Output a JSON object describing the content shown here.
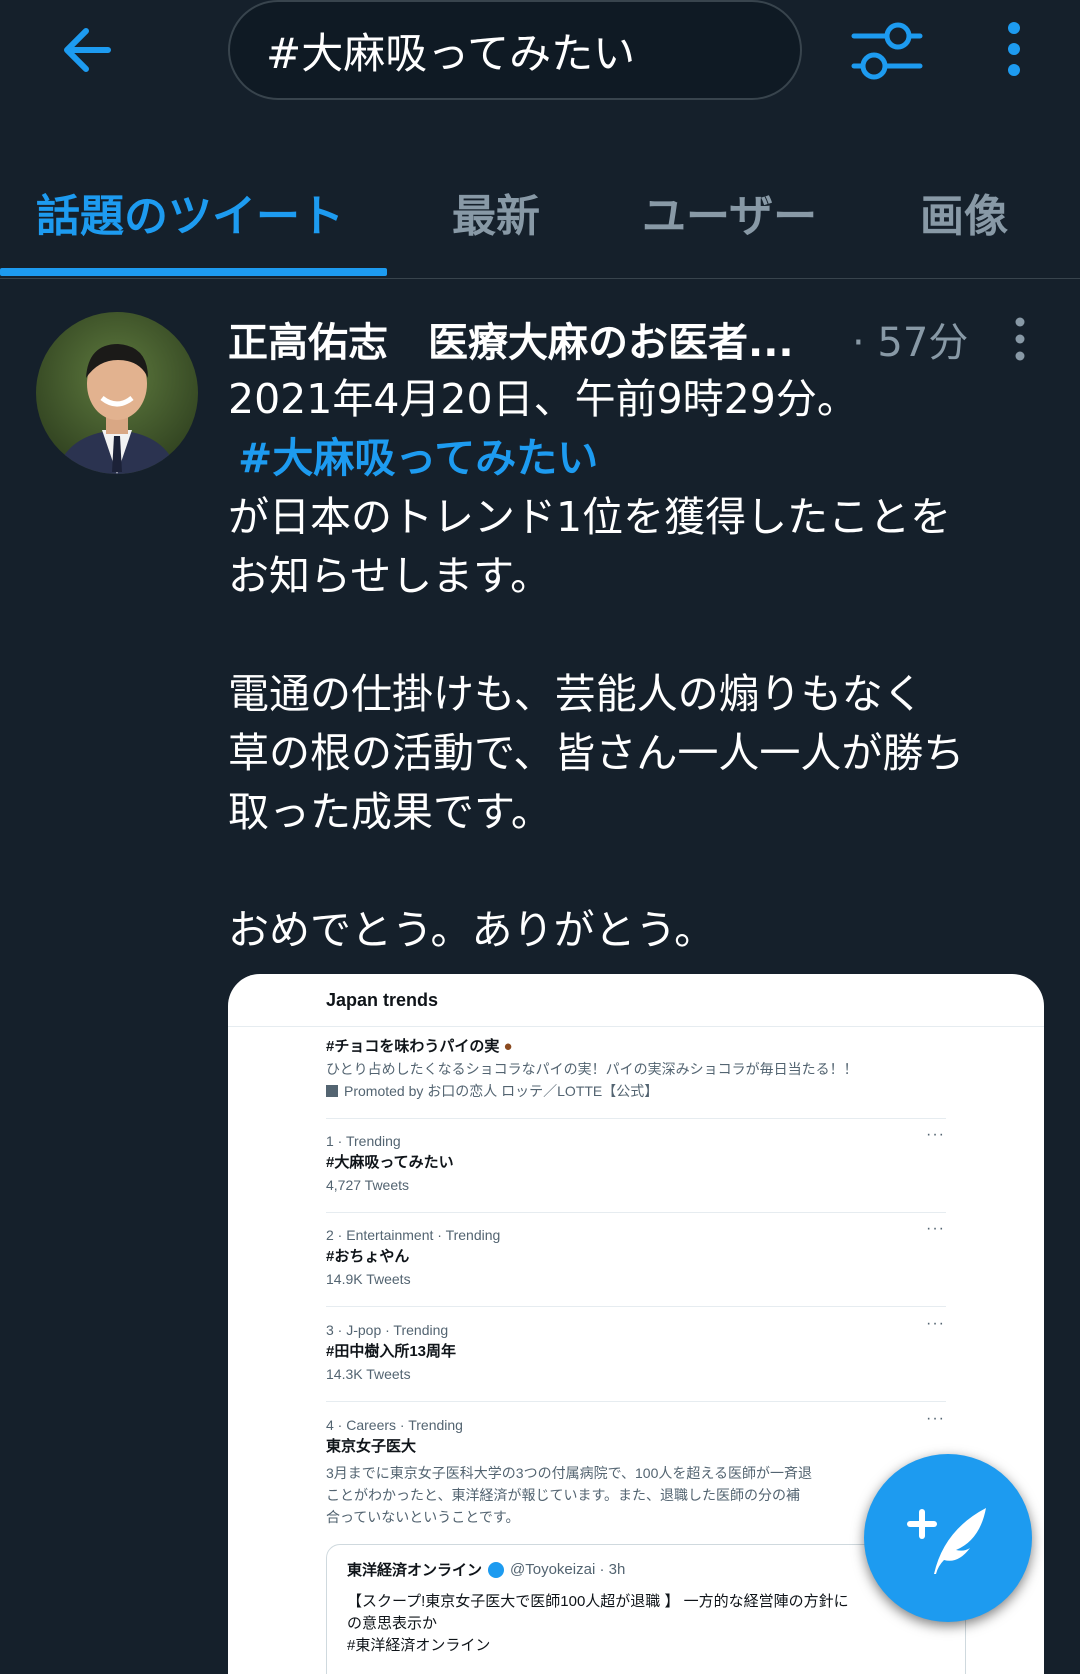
{
  "header": {
    "search_value": "#大麻吸ってみたい",
    "icons": {
      "back": "arrow-left-icon",
      "filter": "sliders-icon",
      "more": "more-vertical-icon"
    }
  },
  "tabs": [
    {
      "label": "話題のツイート",
      "active": true
    },
    {
      "label": "最新",
      "active": false
    },
    {
      "label": "ユーザー",
      "active": false
    },
    {
      "label": "画像",
      "active": false
    }
  ],
  "tweet": {
    "author": "正高佑志　医療大麻のお医者...",
    "time": "· 57分",
    "line1": "2021年4月20日、午前9時29分。",
    "hashtag": "#大麻吸ってみたい",
    "line2": "が日本のトレンド1位を獲得したことを",
    "line3": "お知らせします。",
    "line4": "電通の仕掛けも、芸能人の煽りもなく",
    "line5": "草の根の活動で、皆さん一人一人が勝ち",
    "line6": "取った成果です。",
    "line7": "おめでとう。ありがとう。"
  },
  "media": {
    "title": "Japan trends",
    "promoted": {
      "tag": "#チョコを味わうパイの実",
      "desc": "ひとり占めしたくなるショコラなパイの実！パイの実深みショコラが毎日当たる！！",
      "by": "Promoted by お口の恋人 ロッテ／LOTTE【公式】"
    },
    "trends": [
      {
        "meta": "1 · Trending",
        "tag": "#大麻吸ってみたい",
        "count": "4,727 Tweets"
      },
      {
        "meta": "2 · Entertainment · Trending",
        "tag": "#おちょやん",
        "count": "14.9K Tweets"
      },
      {
        "meta": "3 · J-pop · Trending",
        "tag": "#田中樹入所13周年",
        "count": "14.3K Tweets"
      },
      {
        "meta": "4 · Careers · Trending",
        "tag": "東京女子医大",
        "count": ""
      }
    ],
    "trend4_desc": [
      "3月までに東京女子医科大学の3つの付属病院で、100人を超える医師が一斉退",
      "ことがわかったと、東洋経済が報じています。また、退職した医師の分の補",
      "合っていないということです。"
    ],
    "embedded": {
      "author": "東洋経済オンライン",
      "handle": "@Toyokeizai · 3h",
      "line1": "【スクープ!東京女子医大で医師100人超が退職 】 一方的な経営陣の方針に",
      "line2": "の意思表示か",
      "line3": "#東洋経済オンライン"
    }
  },
  "fab": {
    "icon": "compose-tweet-icon"
  },
  "colors": {
    "background": "#15202b",
    "accent": "#1d9bf0",
    "muted": "#8899a6"
  }
}
